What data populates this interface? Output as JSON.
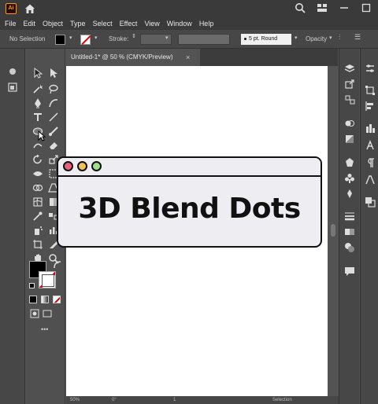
{
  "app": {
    "logo_text": "Ai"
  },
  "menu": [
    "File",
    "Edit",
    "Object",
    "Type",
    "Select",
    "Effect",
    "View",
    "Window",
    "Help"
  ],
  "control_bar": {
    "selection_label": "No Selection",
    "stroke_label": "Stroke:",
    "brush_label": "5 pt. Round",
    "opacity_label": "Opacity"
  },
  "document_tab": {
    "title": "Untitled-1* @ 50 % (CMYK/Preview)",
    "close": "×"
  },
  "status_bar": {
    "zoom": "50%",
    "rotation": "0°",
    "page": "1",
    "tool": "Selection"
  },
  "overlay": {
    "title": "3D Blend Dots",
    "colors": {
      "red": "#e8617a",
      "yellow": "#f2c25a",
      "green": "#9fe08a"
    }
  }
}
